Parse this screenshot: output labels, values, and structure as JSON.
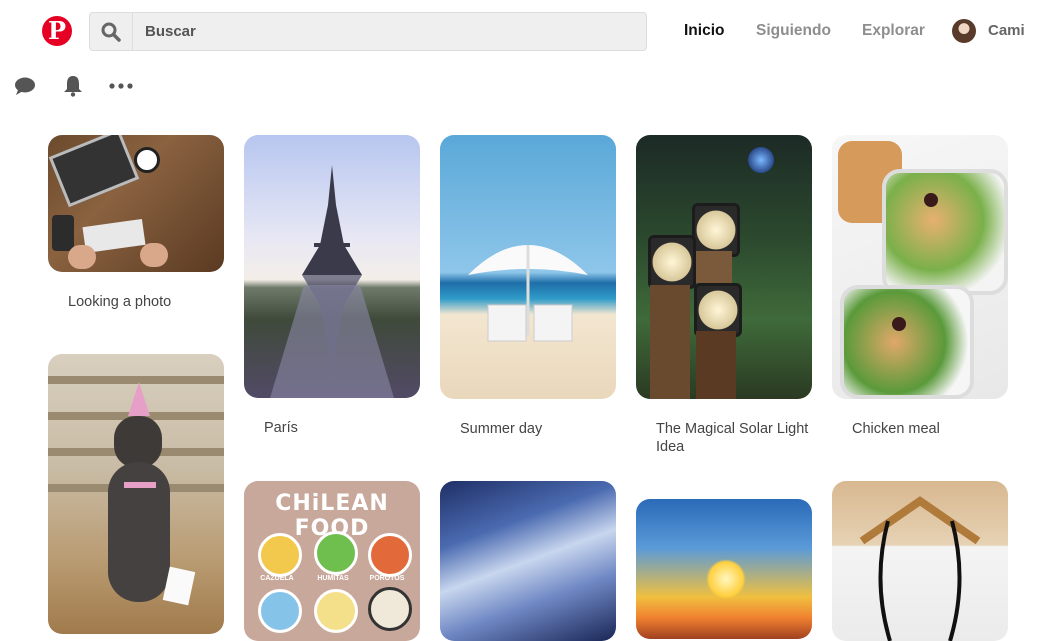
{
  "header": {
    "logo_letter": "P",
    "search": {
      "placeholder": "Buscar"
    },
    "nav": {
      "home": "Inicio",
      "following": "Siguiendo",
      "explore": "Explorar"
    },
    "user": {
      "name": "Cami"
    }
  },
  "pins": [
    {
      "caption": "Looking a photo"
    },
    {
      "caption": "París"
    },
    {
      "caption": "Summer day"
    },
    {
      "caption": "The Magical Solar Light Idea"
    },
    {
      "caption": "Chicken meal"
    }
  ],
  "chilean_food_card": {
    "title": "CHiLEAN FOOD",
    "dishes": [
      "CAZUELA",
      "HUMITAS",
      "POROTOS"
    ]
  },
  "colors": {
    "brand": "#e60023"
  }
}
